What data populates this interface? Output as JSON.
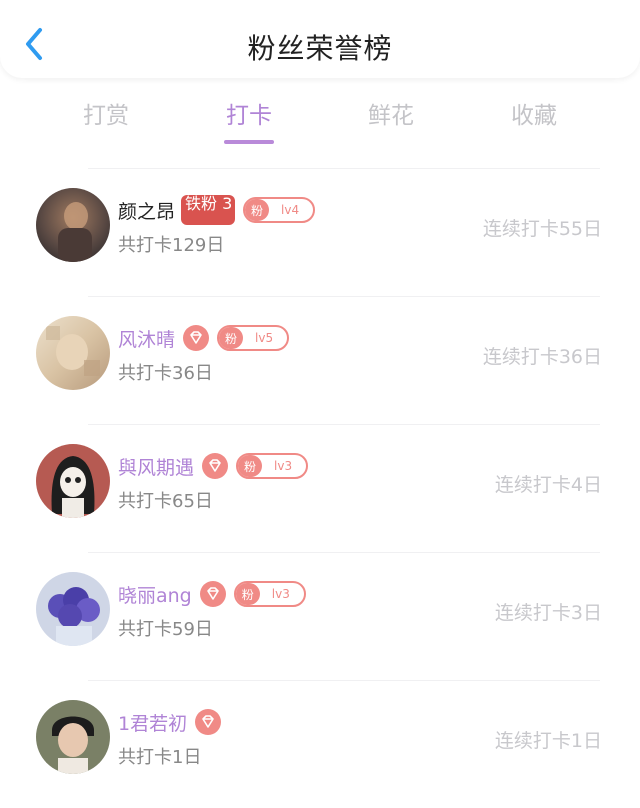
{
  "header": {
    "title": "粉丝荣誉榜"
  },
  "tabs": [
    {
      "label": "打赏",
      "active": false
    },
    {
      "label": "打卡",
      "active": true
    },
    {
      "label": "鲜花",
      "active": false
    },
    {
      "label": "收藏",
      "active": false
    }
  ],
  "rows": [
    {
      "name": "颜之昂",
      "badge_title": "铁粉 3",
      "fan_label": "粉",
      "level": "lv4",
      "total": "共打卡129日",
      "streak": "连续打卡55日"
    },
    {
      "name": "风沐晴",
      "fan_label": "粉",
      "level": "lv5",
      "total": "共打卡36日",
      "streak": "连续打卡36日"
    },
    {
      "name": "與风期遇",
      "fan_label": "粉",
      "level": "lv3",
      "total": "共打卡65日",
      "streak": "连续打卡4日"
    },
    {
      "name": "晓丽ang",
      "fan_label": "粉",
      "level": "lv3",
      "total": "共打卡59日",
      "streak": "连续打卡3日"
    },
    {
      "name": "1君若初",
      "total": "共打卡1日",
      "streak": "连续打卡1日"
    }
  ],
  "colors": {
    "accent": "#b084d6",
    "badge": "#f08a86",
    "iron": "#d9534f"
  }
}
